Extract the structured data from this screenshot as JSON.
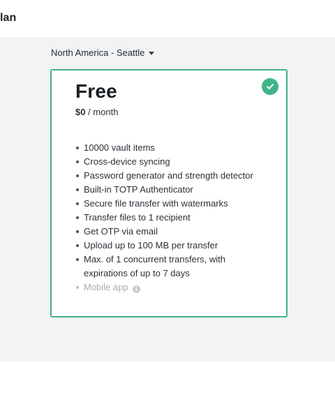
{
  "header": {
    "title": "lan"
  },
  "region": {
    "label": "North America - Seattle"
  },
  "plan": {
    "name": "Free",
    "price": "$0",
    "period": " / month",
    "selected": true,
    "accent_color": "#3fb487",
    "features": [
      {
        "text": "10000 vault items",
        "enabled": true
      },
      {
        "text": "Cross-device syncing",
        "enabled": true
      },
      {
        "text": "Password generator and strength detector",
        "enabled": true
      },
      {
        "text": "Built-in TOTP Authenticator",
        "enabled": true
      },
      {
        "text": "Secure file transfer with watermarks",
        "enabled": true
      },
      {
        "text": "Transfer files to 1 recipient",
        "enabled": true
      },
      {
        "text": "Get OTP via email",
        "enabled": true
      },
      {
        "text": "Upload up to 100 MB per transfer",
        "enabled": true
      },
      {
        "text": "Max. of 1 concurrent transfers, with expirations of up to 7 days",
        "enabled": true
      },
      {
        "text": "Mobile app",
        "enabled": false,
        "info_icon": "info-icon"
      }
    ]
  }
}
